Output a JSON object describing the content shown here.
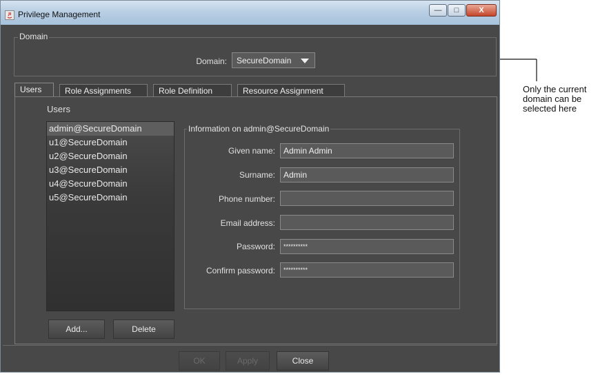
{
  "window": {
    "title": "Privilege Management",
    "buttons": {
      "minimize": "—",
      "maximize": "□",
      "close": "X"
    }
  },
  "domain_group": {
    "legend": "Domain",
    "label": "Domain:",
    "selected_value": "SecureDomain"
  },
  "tabs": [
    {
      "label": "Users",
      "active": true
    },
    {
      "label": "Role Assignments",
      "active": false
    },
    {
      "label": "Role Definition",
      "active": false
    },
    {
      "label": "Resource Assignment",
      "active": false
    }
  ],
  "users_panel": {
    "heading": "Users",
    "items": [
      "admin@SecureDomain",
      "u1@SecureDomain",
      "u2@SecureDomain",
      "u3@SecureDomain",
      "u4@SecureDomain",
      "u5@SecureDomain"
    ],
    "selected_index": 0,
    "add_label": "Add...",
    "delete_label": "Delete"
  },
  "info": {
    "legend": "Information on admin@SecureDomain",
    "given_name_label": "Given name:",
    "given_name_value": "Admin Admin",
    "surname_label": "Surname:",
    "surname_value": "Admin",
    "phone_label": "Phone number:",
    "phone_value": "",
    "email_label": "Email address:",
    "email_value": "",
    "password_label": "Password:",
    "password_value": "**********",
    "confirm_label": "Confirm password:",
    "confirm_value": "**********"
  },
  "footer": {
    "ok_label": "OK",
    "apply_label": "Apply",
    "close_label": "Close"
  },
  "callout": {
    "text": "Only the current domain can be selected here"
  },
  "colors": {
    "dialog_bg": "#484848",
    "titlebar": "#b9cfe4",
    "close_button": "#c4452a"
  }
}
